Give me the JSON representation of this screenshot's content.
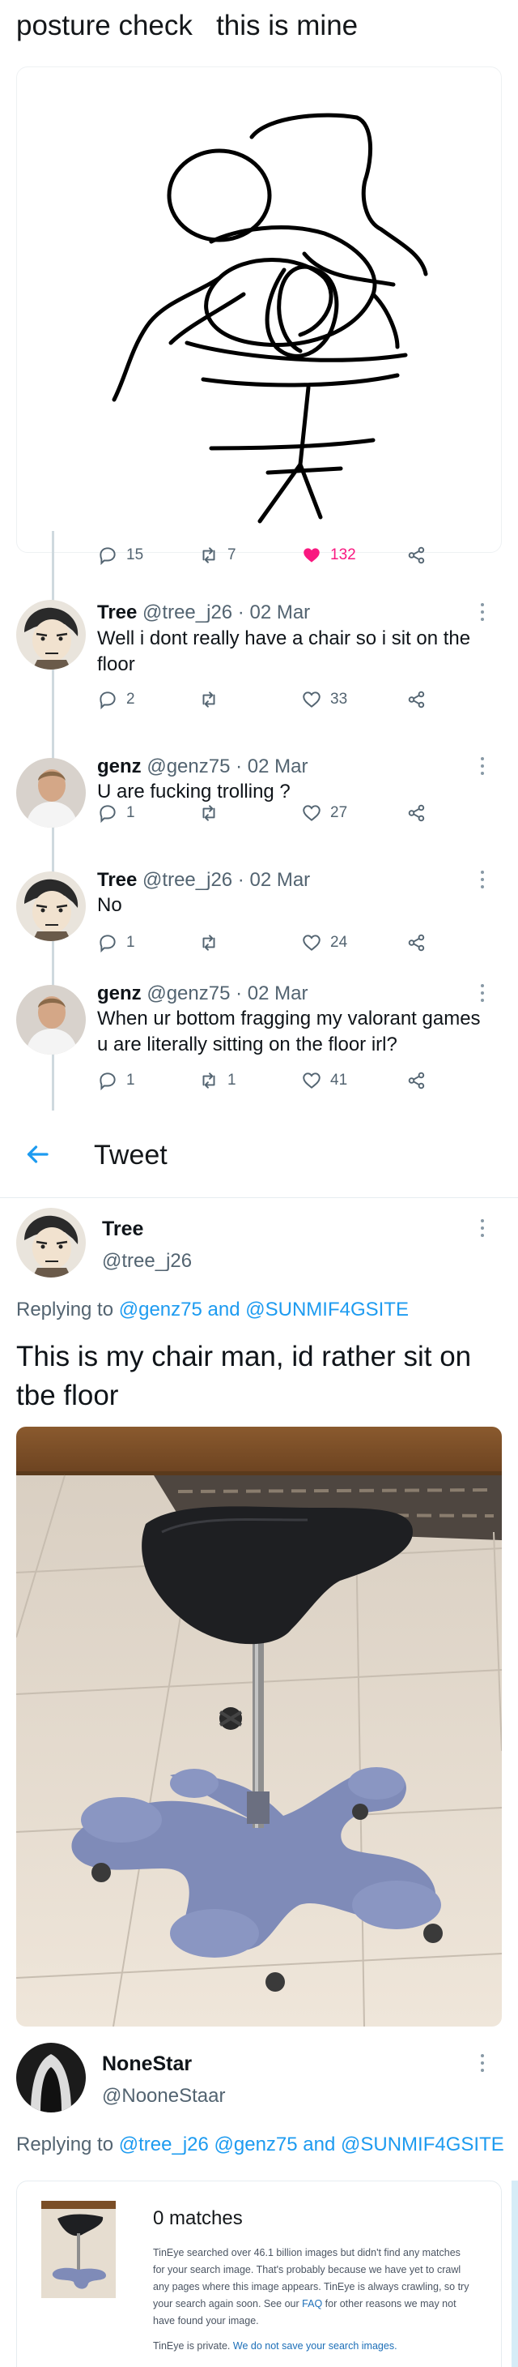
{
  "top_tweet": {
    "text": "posture check   this is mine",
    "stats": {
      "replies": "15",
      "retweets": "7",
      "likes": "132"
    }
  },
  "replies": [
    {
      "name": "Tree",
      "handle": "@tree_j26",
      "date": "02 Mar",
      "text": "Well i dont really have a chair so i sit on the floor",
      "stats": {
        "replies": "2",
        "retweets": "",
        "likes": "33"
      }
    },
    {
      "name": "genz",
      "handle": "@genz75",
      "date": "02 Mar",
      "text": "U are fucking trolling ?",
      "stats": {
        "replies": "1",
        "retweets": "",
        "likes": "27"
      }
    },
    {
      "name": "Tree",
      "handle": "@tree_j26",
      "date": "02 Mar",
      "text": "No",
      "stats": {
        "replies": "1",
        "retweets": "",
        "likes": "24"
      }
    },
    {
      "name": "genz",
      "handle": "@genz75",
      "date": "02 Mar",
      "text": "When ur bottom fragging my valorant games u are literally sitting  on the floor irl?",
      "stats": {
        "replies": "1",
        "retweets": "1",
        "likes": "41"
      }
    }
  ],
  "header": {
    "title": "Tweet"
  },
  "main_tweet": {
    "name": "Tree",
    "handle": "@tree_j26",
    "replying_prefix": "Replying to",
    "replying_to_1": "@genz75",
    "replying_and": "and",
    "replying_to_2": "@SUNMIF4GSITE",
    "text": "This is my chair man, id rather sit on tbe floor"
  },
  "reply_tweet": {
    "name": "NoneStar",
    "handle": "@NooneStaar",
    "replying_prefix": "Replying to",
    "replying_to_1": "@tree_j26",
    "replying_to_2": "@genz75",
    "replying_and": "and",
    "replying_to_3": "@SUNMIF4GSITE"
  },
  "tineye": {
    "title": "0 matches",
    "body_1": "TinEye searched over 46.1 billion images but didn't find any matches for your search image. That's probably because we have yet to crawl any pages where this image appears. TinEye is always crawling, so try your search again soon. See our",
    "faq": "FAQ",
    "body_2": "for other reasons we may not have found your image.",
    "private_1": "TinEye is private.",
    "private_2": "We do not save your search images."
  },
  "colors": {
    "accent": "#1d9bf0",
    "like": "#f91880",
    "muted": "#536471",
    "chair_seat": "#1e1f22",
    "chair_base": "#7f8bb8"
  },
  "icons": [
    "reply-icon",
    "retweet-icon",
    "heart-icon",
    "share-icon",
    "more-icon",
    "back-arrow-icon"
  ]
}
